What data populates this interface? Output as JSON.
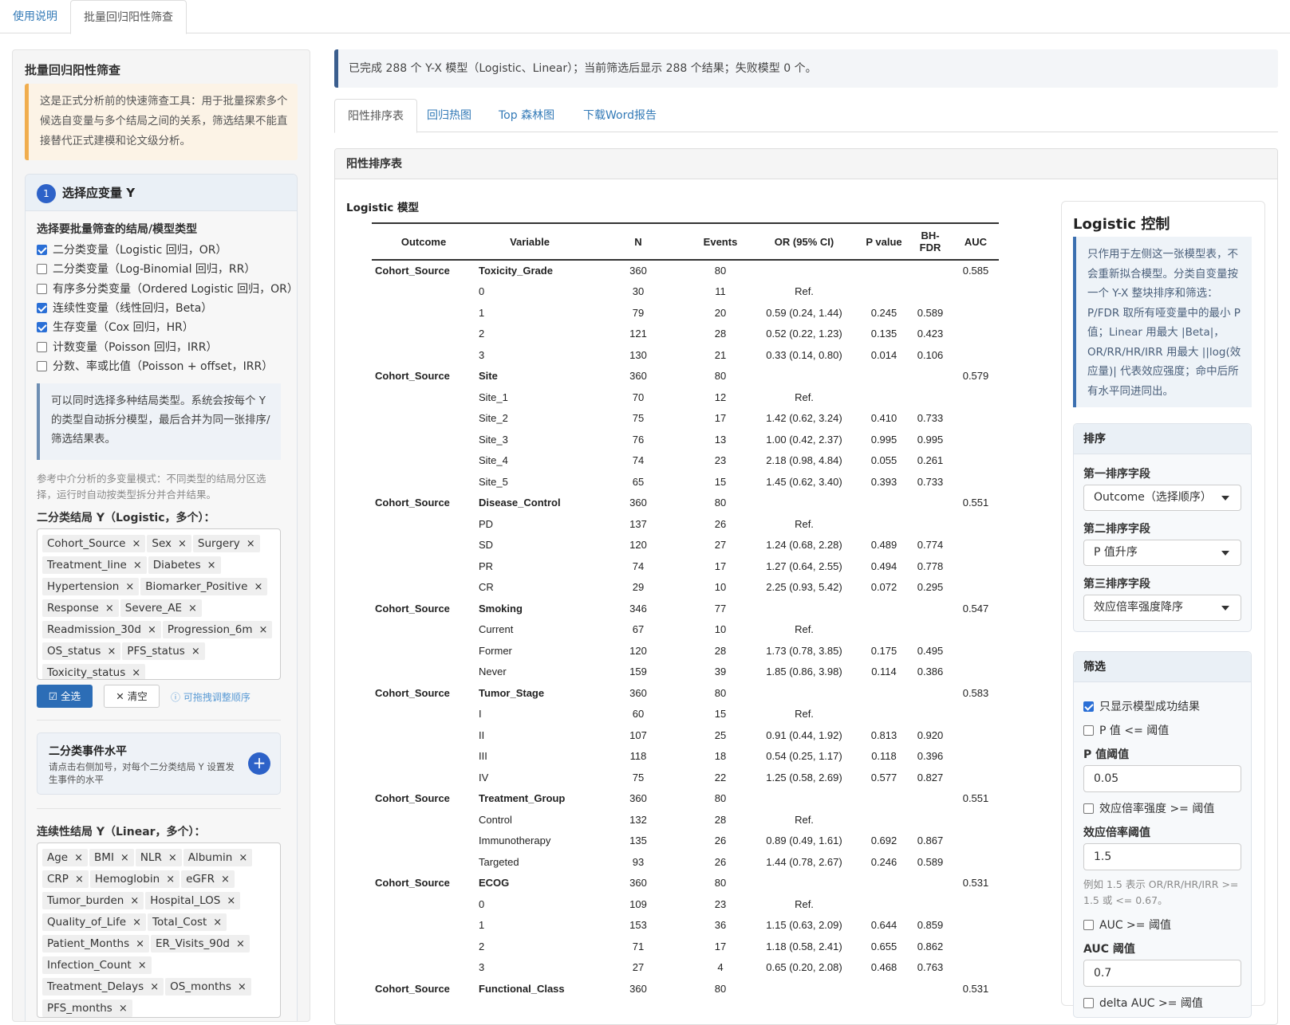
{
  "top_tabs": [
    "使用说明",
    "批量回归阳性筛查"
  ],
  "sidebar": {
    "title": "批量回归阳性筛查",
    "warning": "这是正式分析前的快速筛查工具：用于批量探索多个候选自变量与多个结局之间的关系，筛选结果不能直接替代正式建模和论文级分析。",
    "step_number": "1",
    "step_title": "选择应变量 Y",
    "outcome_types_label": "选择要批量筛查的结局/模型类型",
    "outcome_types": [
      {
        "label": "二分类变量（Logistic 回归，OR）",
        "checked": true
      },
      {
        "label": "二分类变量（Log-Binomial 回归，RR）",
        "checked": false
      },
      {
        "label": "有序多分类变量（Ordered Logistic 回归，OR）",
        "checked": false
      },
      {
        "label": "连续性变量（线性回归，Beta）",
        "checked": true
      },
      {
        "label": "生存变量（Cox 回归，HR）",
        "checked": true
      },
      {
        "label": "计数变量（Poisson 回归，IRR）",
        "checked": false
      },
      {
        "label": "分数、率或比值（Poisson + offset，IRR）",
        "checked": false
      }
    ],
    "multi_info": "可以同时选择多种结局类型。系统会按每个 Y 的类型自动拆分模型，最后合并为同一张排序/筛选结果表。",
    "note": "参考中介分析的多变量模式：不同类型的结局分区选择，运行时自动按类型拆分并合并结果。",
    "binary_label": "二分类结局 Y（Logistic，多个）：",
    "binary_tags": [
      "Cohort_Source",
      "Sex",
      "Surgery",
      "Treatment_line",
      "Diabetes",
      "Hypertension",
      "Biomarker_Positive",
      "Response",
      "Severe_AE",
      "Readmission_30d",
      "Progression_6m",
      "OS_status",
      "PFS_status",
      "Toxicity_status"
    ],
    "select_all": "全选",
    "clear": "清空",
    "drag_hint": "可拖拽调整顺序",
    "event_title": "二分类事件水平",
    "event_sub": "请点击右侧加号，对每个二分类结局 Y 设置发生事件的水平",
    "event_plus": "+",
    "continuous_label": "连续性结局 Y（Linear，多个）：",
    "continuous_tags": [
      "Age",
      "BMI",
      "NLR",
      "Albumin",
      "CRP",
      "Hemoglobin",
      "eGFR",
      "Tumor_burden",
      "Hospital_LOS",
      "Quality_of_Life",
      "Total_Cost",
      "Patient_Months",
      "ER_Visits_90d",
      "Infection_Count",
      "Treatment_Delays",
      "OS_months",
      "PFS_months"
    ],
    "tag_x": "×"
  },
  "main": {
    "banner": "已完成 288 个 Y-X 模型（Logistic、Linear）；当前筛选后显示 288 个结果；失败模型 0 个。",
    "tabs": [
      "阳性排序表",
      "回归热图",
      "Top 森林图",
      "下载Word报告"
    ],
    "panel_title": "阳性排序表",
    "model_title": "Logistic 模型",
    "columns": [
      "Outcome",
      "Variable",
      "N",
      "Events",
      "OR (95% CI)",
      "P value",
      "BH-FDR",
      "AUC"
    ],
    "groups": [
      {
        "outcome": "Cohort_Source",
        "variable": "Toxicity_Grade",
        "n": "360",
        "events": "80",
        "auc": "0.585",
        "levels": [
          {
            "name": "0",
            "n": "30",
            "events": "11",
            "or": "Ref.",
            "p": "",
            "fdr": ""
          },
          {
            "name": "1",
            "n": "79",
            "events": "20",
            "or": "0.59 (0.24, 1.44)",
            "p": "0.245",
            "fdr": "0.589"
          },
          {
            "name": "2",
            "n": "121",
            "events": "28",
            "or": "0.52 (0.22, 1.23)",
            "p": "0.135",
            "fdr": "0.423"
          },
          {
            "name": "3",
            "n": "130",
            "events": "21",
            "or": "0.33 (0.14, 0.80)",
            "p": "0.014",
            "fdr": "0.106"
          }
        ]
      },
      {
        "outcome": "Cohort_Source",
        "variable": "Site",
        "n": "360",
        "events": "80",
        "auc": "0.579",
        "levels": [
          {
            "name": "Site_1",
            "n": "70",
            "events": "12",
            "or": "Ref.",
            "p": "",
            "fdr": ""
          },
          {
            "name": "Site_2",
            "n": "75",
            "events": "17",
            "or": "1.42 (0.62, 3.24)",
            "p": "0.410",
            "fdr": "0.733"
          },
          {
            "name": "Site_3",
            "n": "76",
            "events": "13",
            "or": "1.00 (0.42, 2.37)",
            "p": "0.995",
            "fdr": "0.995"
          },
          {
            "name": "Site_4",
            "n": "74",
            "events": "23",
            "or": "2.18 (0.98, 4.84)",
            "p": "0.055",
            "fdr": "0.261"
          },
          {
            "name": "Site_5",
            "n": "65",
            "events": "15",
            "or": "1.45 (0.62, 3.40)",
            "p": "0.393",
            "fdr": "0.733"
          }
        ]
      },
      {
        "outcome": "Cohort_Source",
        "variable": "Disease_Control",
        "n": "360",
        "events": "80",
        "auc": "0.551",
        "levels": [
          {
            "name": "PD",
            "n": "137",
            "events": "26",
            "or": "Ref.",
            "p": "",
            "fdr": ""
          },
          {
            "name": "SD",
            "n": "120",
            "events": "27",
            "or": "1.24 (0.68, 2.28)",
            "p": "0.489",
            "fdr": "0.774"
          },
          {
            "name": "PR",
            "n": "74",
            "events": "17",
            "or": "1.27 (0.64, 2.55)",
            "p": "0.494",
            "fdr": "0.778"
          },
          {
            "name": "CR",
            "n": "29",
            "events": "10",
            "or": "2.25 (0.93, 5.42)",
            "p": "0.072",
            "fdr": "0.295"
          }
        ]
      },
      {
        "outcome": "Cohort_Source",
        "variable": "Smoking",
        "n": "346",
        "events": "77",
        "auc": "0.547",
        "levels": [
          {
            "name": "Current",
            "n": "67",
            "events": "10",
            "or": "Ref.",
            "p": "",
            "fdr": ""
          },
          {
            "name": "Former",
            "n": "120",
            "events": "28",
            "or": "1.73 (0.78, 3.85)",
            "p": "0.175",
            "fdr": "0.495"
          },
          {
            "name": "Never",
            "n": "159",
            "events": "39",
            "or": "1.85 (0.86, 3.98)",
            "p": "0.114",
            "fdr": "0.386"
          }
        ]
      },
      {
        "outcome": "Cohort_Source",
        "variable": "Tumor_Stage",
        "n": "360",
        "events": "80",
        "auc": "0.583",
        "levels": [
          {
            "name": "I",
            "n": "60",
            "events": "15",
            "or": "Ref.",
            "p": "",
            "fdr": ""
          },
          {
            "name": "II",
            "n": "107",
            "events": "25",
            "or": "0.91 (0.44, 1.92)",
            "p": "0.813",
            "fdr": "0.920"
          },
          {
            "name": "III",
            "n": "118",
            "events": "18",
            "or": "0.54 (0.25, 1.17)",
            "p": "0.118",
            "fdr": "0.396"
          },
          {
            "name": "IV",
            "n": "75",
            "events": "22",
            "or": "1.25 (0.58, 2.69)",
            "p": "0.577",
            "fdr": "0.827"
          }
        ]
      },
      {
        "outcome": "Cohort_Source",
        "variable": "Treatment_Group",
        "n": "360",
        "events": "80",
        "auc": "0.551",
        "levels": [
          {
            "name": "Control",
            "n": "132",
            "events": "28",
            "or": "Ref.",
            "p": "",
            "fdr": ""
          },
          {
            "name": "Immunotherapy",
            "n": "135",
            "events": "26",
            "or": "0.89 (0.49, 1.61)",
            "p": "0.692",
            "fdr": "0.867"
          },
          {
            "name": "Targeted",
            "n": "93",
            "events": "26",
            "or": "1.44 (0.78, 2.67)",
            "p": "0.246",
            "fdr": "0.589"
          }
        ]
      },
      {
        "outcome": "Cohort_Source",
        "variable": "ECOG",
        "n": "360",
        "events": "80",
        "auc": "0.531",
        "levels": [
          {
            "name": "0",
            "n": "109",
            "events": "23",
            "or": "Ref.",
            "p": "",
            "fdr": ""
          },
          {
            "name": "1",
            "n": "153",
            "events": "36",
            "or": "1.15 (0.63, 2.09)",
            "p": "0.644",
            "fdr": "0.859"
          },
          {
            "name": "2",
            "n": "71",
            "events": "17",
            "or": "1.18 (0.58, 2.41)",
            "p": "0.655",
            "fdr": "0.862"
          },
          {
            "name": "3",
            "n": "27",
            "events": "4",
            "or": "0.65 (0.20, 2.08)",
            "p": "0.468",
            "fdr": "0.763"
          }
        ]
      },
      {
        "outcome": "Cohort_Source",
        "variable": "Functional_Class",
        "n": "360",
        "events": "80",
        "auc": "0.531",
        "levels": []
      }
    ]
  },
  "right": {
    "title": "Logistic 控制",
    "info": "只作用于左侧这一张模型表，不会重新拟合模型。分类自变量按一个 Y-X 整块排序和筛选：P/FDR 取所有哑变量中的最小 P 值；Linear 用最大 |Beta|，OR/RR/HR/IRR 用最大 ||log(效应量)| 代表效应强度；命中后所有水平同进同出。",
    "sort_title": "排序",
    "sort1_label": "第一排序字段",
    "sort1_value": "Outcome（选择顺序）",
    "sort2_label": "第二排序字段",
    "sort2_value": "P 值升序",
    "sort3_label": "第三排序字段",
    "sort3_value": "效应倍率强度降序",
    "filter_title": "筛选",
    "only_success": "只显示模型成功结果",
    "p_filter": "P 值 <= 阈值",
    "p_threshold_label": "P 值阈值",
    "p_threshold": "0.05",
    "effect_filter": "效应倍率强度 >= 阈值",
    "effect_threshold_label": "效应倍率阈值",
    "effect_threshold": "1.5",
    "effect_hint": "例如 1.5 表示 OR/RR/HR/IRR >= 1.5 或 <= 0.67。",
    "auc_filter": "AUC >= 阈值",
    "auc_threshold_label": "AUC 阈值",
    "auc_threshold": "0.7",
    "delta_auc_filter": "delta AUC >= 阈值"
  }
}
